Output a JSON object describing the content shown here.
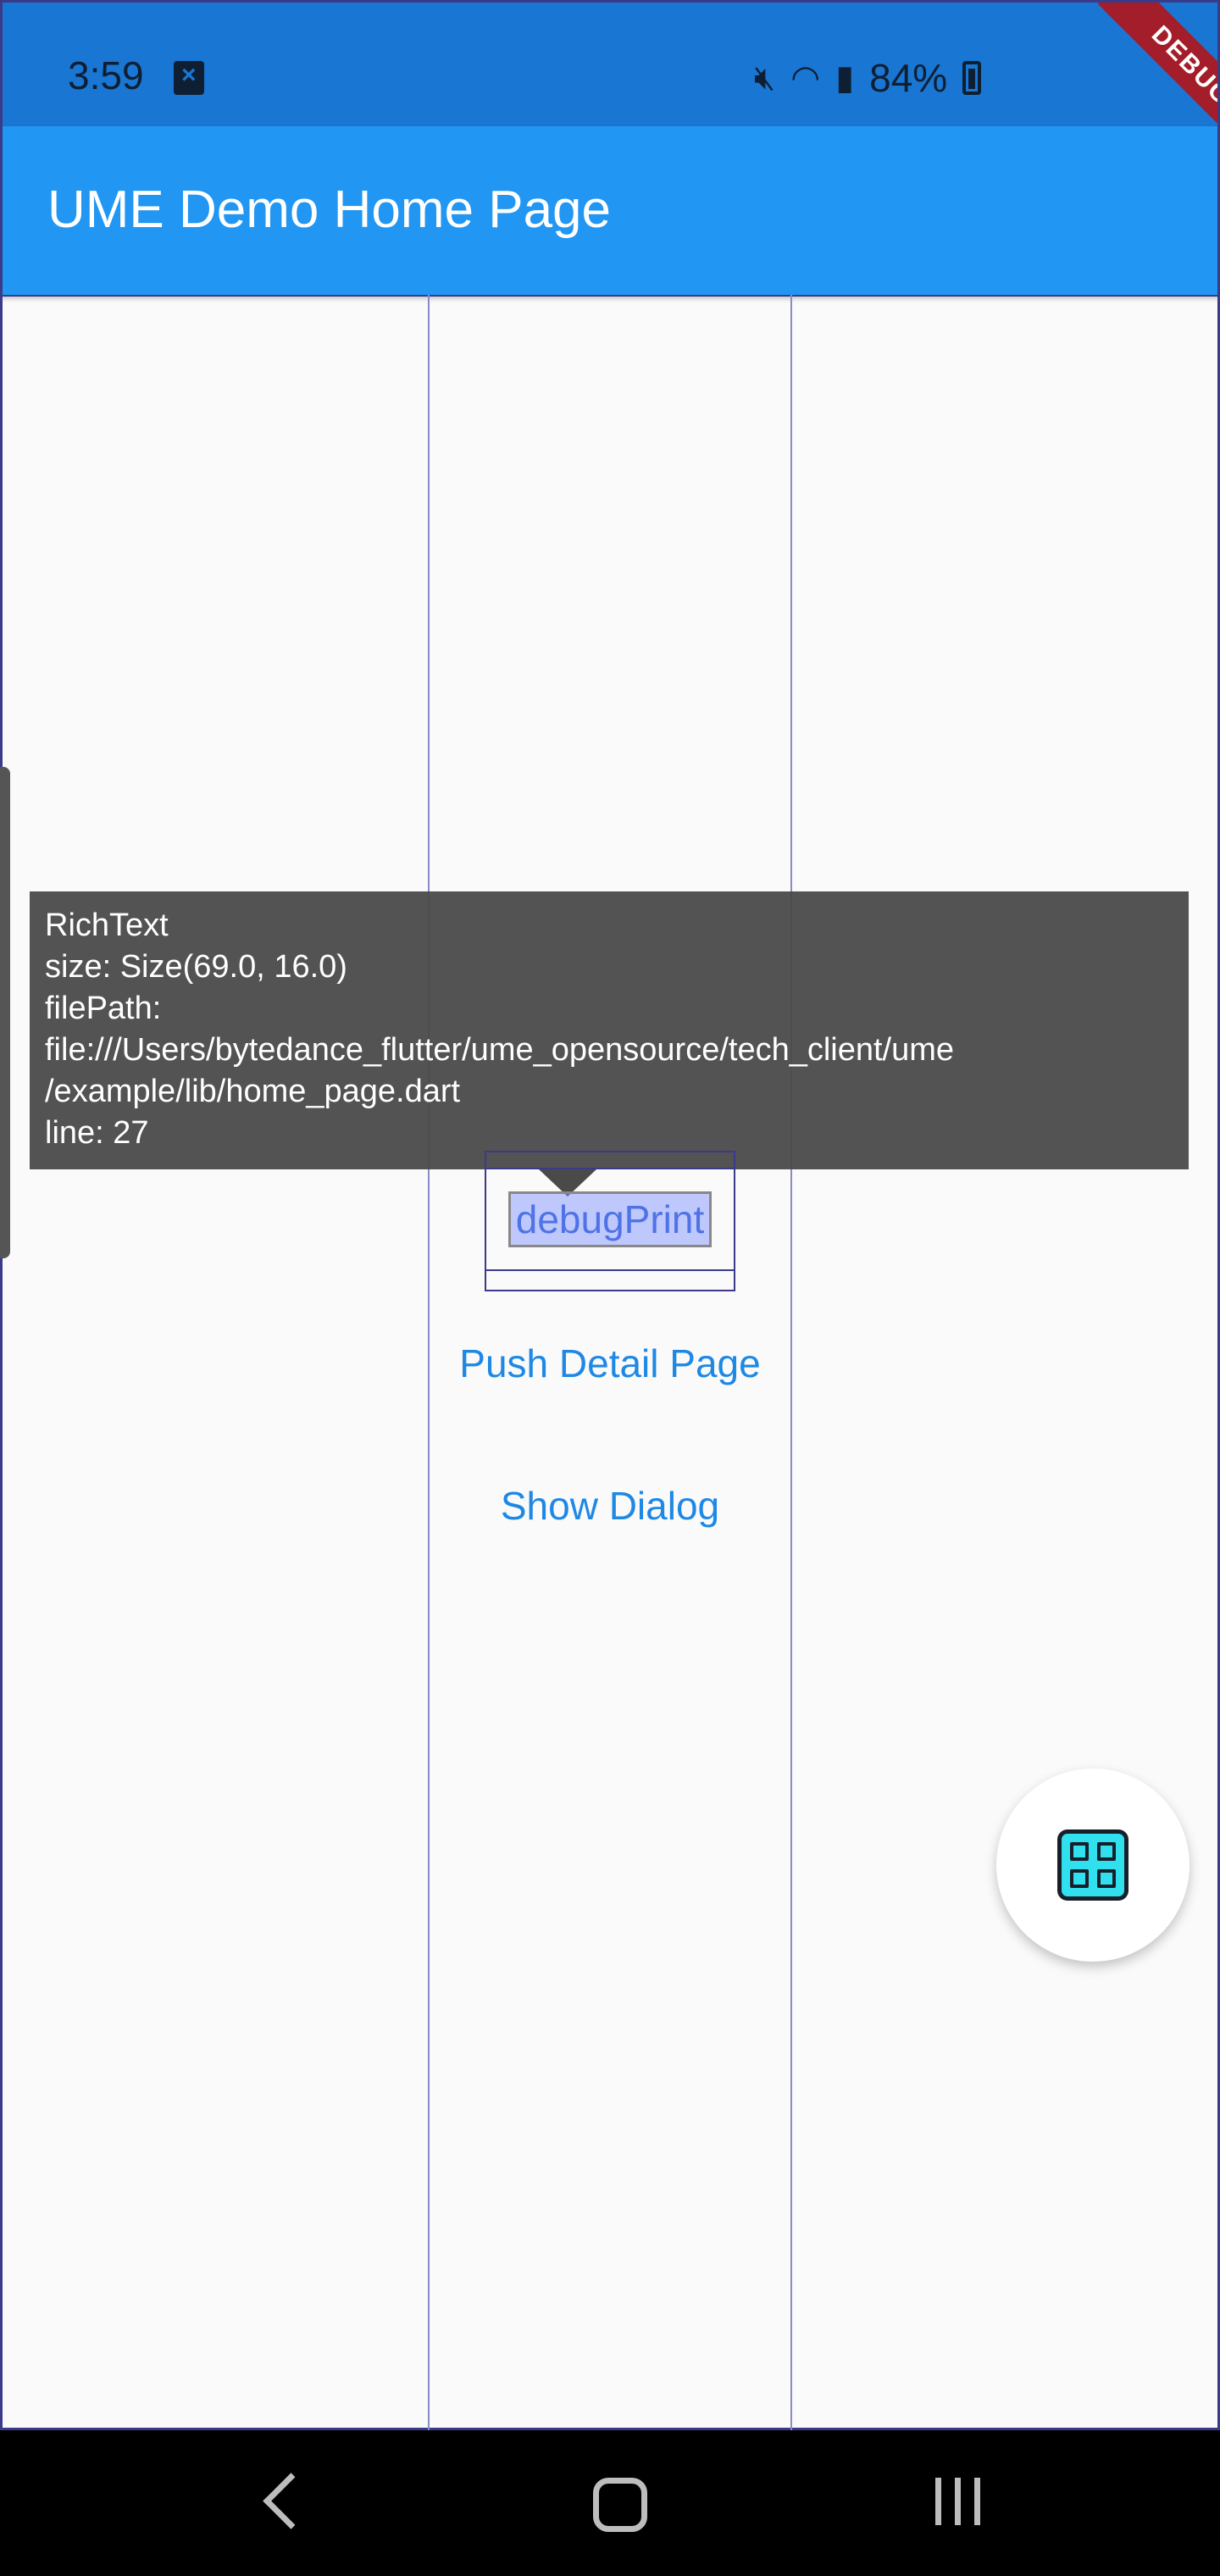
{
  "status_bar": {
    "time": "3:59",
    "battery_percent": "84%",
    "icons": [
      "sim-error-icon",
      "mute-icon",
      "wifi-icon",
      "signal-icon",
      "battery-charging-icon"
    ],
    "debug_banner": "DEBUG"
  },
  "app_bar": {
    "title": "UME Demo Home Page",
    "color": "#2196f3"
  },
  "inspector": {
    "widget_type": "RichText",
    "size": "size: Size(69.0, 16.0)",
    "file_path_label": "filePath:",
    "file_path_line1": "file:///Users/bytedance_flutter/ume_opensource/tech_client/ume",
    "file_path_line2": "/example/lib/home_page.dart",
    "line": "line: 27"
  },
  "buttons": {
    "debug_print": "debugPrint",
    "push_detail": "Push Detail Page",
    "show_dialog": "Show Dialog"
  },
  "fab": {
    "icon": "grid-icon",
    "icon_color": "#31e0ef"
  },
  "nav_bar": {
    "icons": [
      "back-icon",
      "home-icon",
      "recents-icon"
    ]
  }
}
